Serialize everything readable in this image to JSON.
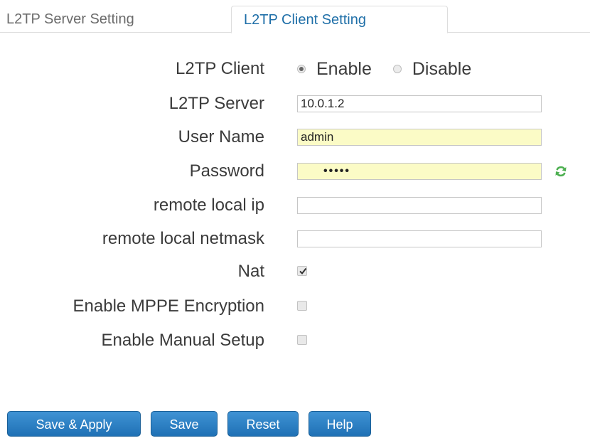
{
  "tabs": [
    {
      "label": "L2TP Server Setting",
      "active": false
    },
    {
      "label": "L2TP Client Setting",
      "active": true
    }
  ],
  "form": {
    "l2tp_client": {
      "label": "L2TP Client",
      "options": [
        "Enable",
        "Disable"
      ],
      "selected": "Enable"
    },
    "l2tp_server": {
      "label": "L2TP Server",
      "value": "10.0.1.2"
    },
    "user_name": {
      "label": "User Name",
      "value": "admin"
    },
    "password": {
      "label": "Password",
      "masked": "•••••"
    },
    "remote_local_ip": {
      "label": "remote local ip",
      "value": ""
    },
    "remote_local_netmask": {
      "label": "remote local netmask",
      "value": ""
    },
    "nat": {
      "label": "Nat",
      "checked": true
    },
    "mppe": {
      "label": "Enable MPPE Encryption",
      "checked": false
    },
    "manual_setup": {
      "label": "Enable Manual Setup",
      "checked": false
    }
  },
  "buttons": {
    "save_apply": "Save & Apply",
    "save": "Save",
    "reset": "Reset",
    "help": "Help"
  },
  "colors": {
    "accent": "#2a80c4",
    "tab_active_text": "#1f6fa8",
    "autofill_bg": "#fbfbc6",
    "refresh_icon": "#4caf50"
  }
}
